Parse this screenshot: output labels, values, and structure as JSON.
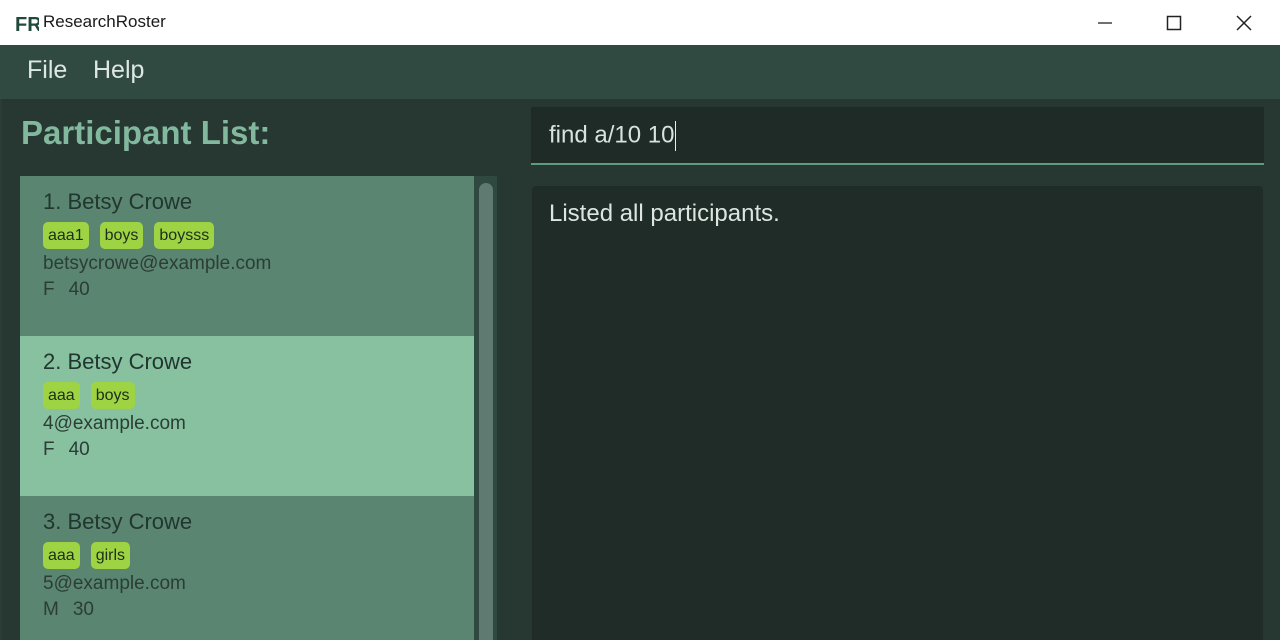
{
  "window": {
    "title": "ResearchRoster",
    "logo_text": "FR"
  },
  "menu": {
    "items": [
      {
        "label": "File"
      },
      {
        "label": "Help"
      }
    ]
  },
  "left_panel": {
    "title": "Participant List:"
  },
  "participants": [
    {
      "name": "1. Betsy Crowe",
      "tags": [
        "aaa1",
        "boys",
        "boysss"
      ],
      "email": "betsycrowe@example.com",
      "gender": "F",
      "age": "40",
      "selected": false
    },
    {
      "name": "2. Betsy Crowe",
      "tags": [
        "aaa",
        "boys"
      ],
      "email": "4@example.com",
      "gender": "F",
      "age": "40",
      "selected": true
    },
    {
      "name": "3. Betsy Crowe",
      "tags": [
        "aaa",
        "girls"
      ],
      "email": "5@example.com",
      "gender": "M",
      "age": "30",
      "selected": false
    }
  ],
  "command": {
    "value": "find a/10 10"
  },
  "result": {
    "message": "Listed all participants."
  },
  "colors": {
    "accent": "#82b89d",
    "card": "#5a8570",
    "card_selected": "#87c1a0",
    "tag": "#9ed444",
    "background": "#263831"
  }
}
